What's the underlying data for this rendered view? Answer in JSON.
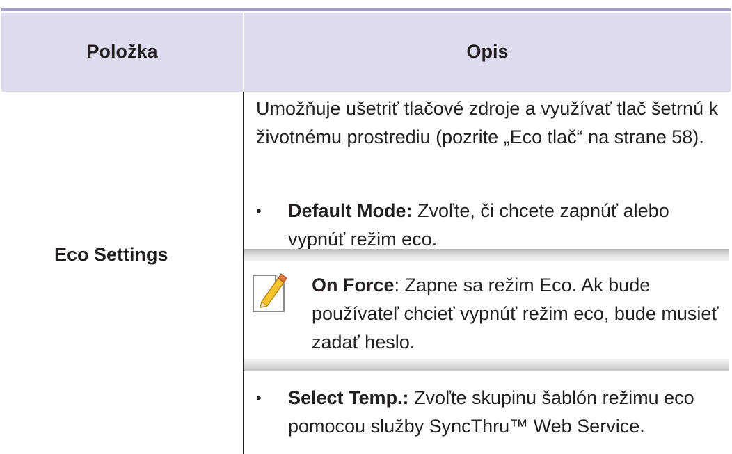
{
  "table": {
    "headers": {
      "item": "Položka",
      "description": "Opis"
    },
    "row": {
      "item": "Eco Settings",
      "intro": "Umožňuje ušetriť tlačové zdroje a využívať tlač šetrnú k životnému prostrediu (pozrite „Eco tlač“ na strane 58).",
      "bullets": [
        {
          "symbol": "•",
          "term": "Default Mode:",
          "text": " Zvoľte, či chcete zapnúť alebo vypnúť režim eco."
        },
        {
          "symbol": "•",
          "term": "Select Temp.:",
          "text": " Zvoľte skupinu šablón režimu eco pomocou služby SyncThru™ Web Service."
        }
      ],
      "note": {
        "icon": "note-pencil-icon",
        "term": "On Force",
        "text": ": Zapne sa režim Eco. Ak bude používateľ chcieť vypnúť režim eco, bude musieť zadať heslo."
      }
    }
  },
  "colors": {
    "header_rule": "#a29cc8",
    "header_fill": "#dddbee",
    "text": "#231f20",
    "note_bar": "#c8c8c8"
  }
}
